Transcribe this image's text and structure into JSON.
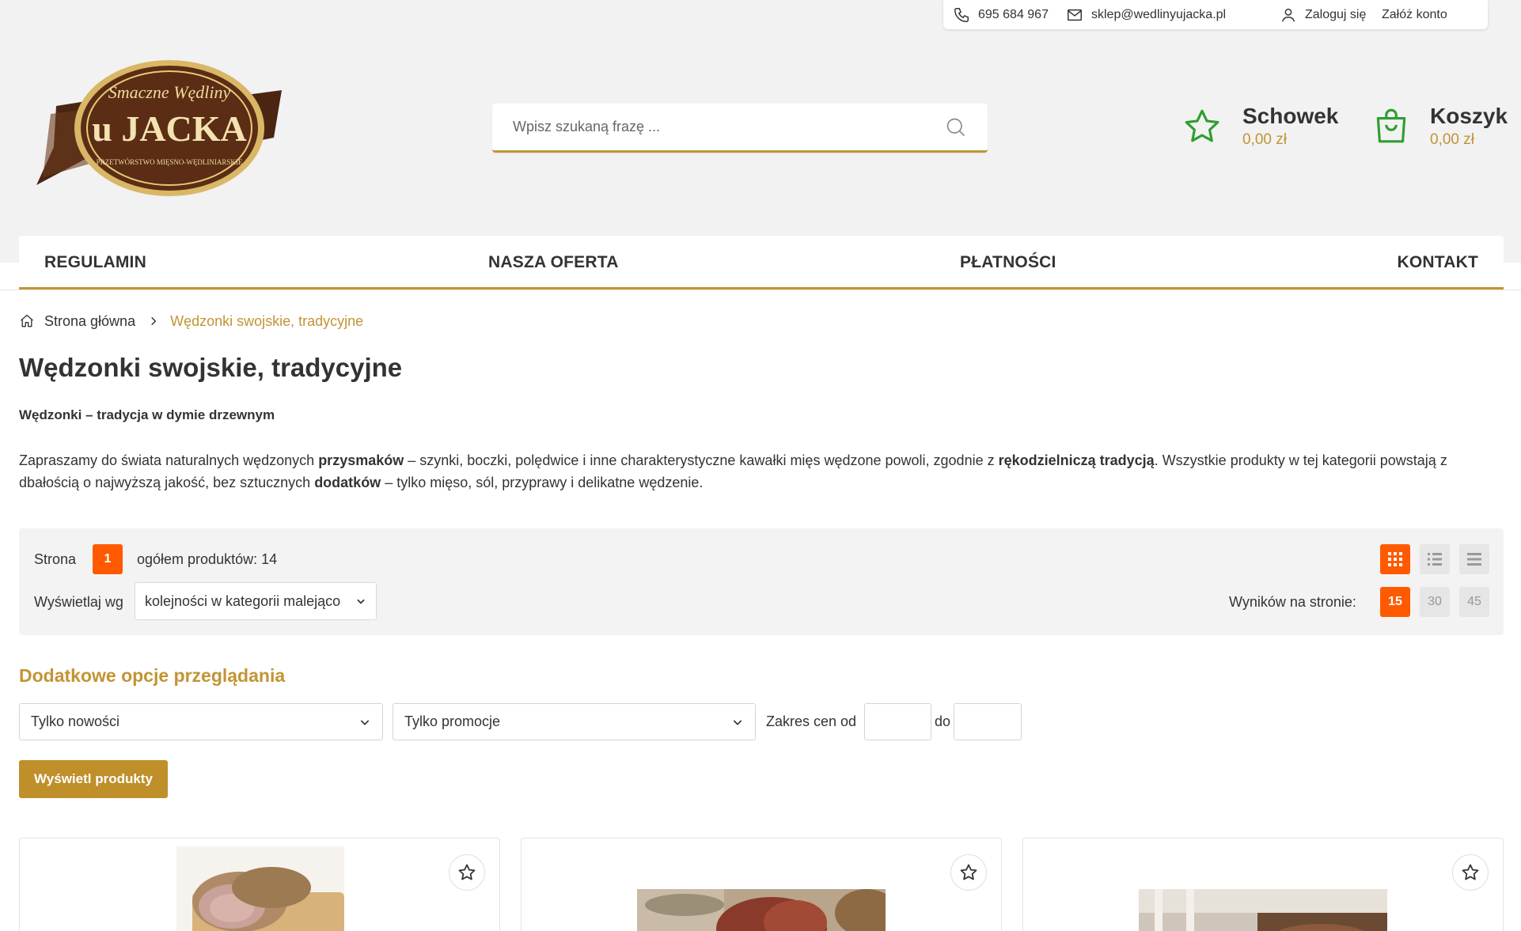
{
  "topbar": {
    "phone": "695 684 967",
    "email": "sklep@wedlinyujacka.pl",
    "login": "Zaloguj się",
    "register": "Załóż konto"
  },
  "logo": {
    "script_text": "Smaczne Wędliny",
    "main_text": "u JACKA",
    "ring_text": "PRZETWÓRSTWO MIĘSNO-WĘDLINIARSKIE"
  },
  "search": {
    "placeholder": "Wpisz szukaną frazę ..."
  },
  "wishlist": {
    "label": "Schowek",
    "amount": "0,00 zł"
  },
  "cart": {
    "label": "Koszyk",
    "amount": "0,00 zł"
  },
  "nav": {
    "items": [
      "REGULAMIN",
      "NASZA OFERTA",
      "PŁATNOŚCI",
      "KONTAKT"
    ]
  },
  "breadcrumb": {
    "home": "Strona główna",
    "current": "Wędzonki swojskie, tradycyjne"
  },
  "page": {
    "title": "Wędzonki swojskie, tradycyjne",
    "subhead": "Wędzonki – tradycja w dymie drzewnym",
    "desc": {
      "p1": "Zapraszamy do świata naturalnych wędzonych ",
      "b1": "przysmaków",
      "p2": " – szynki, boczki, polędwice i inne charakterystyczne kawałki mięs wędzone powoli, zgodnie z ",
      "b2": "rękodzielniczą tradycją",
      "p3": ". Wszystkie produkty w tej kategorii powstają z dbałością o najwyższą jakość, bez sztucznych ",
      "b3": "dodatków",
      "p4": " – tylko mięso, sól, przyprawy i delikatne wędzenie."
    }
  },
  "toolbar": {
    "page_label": "Strona",
    "current_page": "1",
    "total": "ogółem produktów: 14",
    "sort_label": "Wyświetlaj wg",
    "sort_value": "kolejności w kategorii malejąco",
    "per_page_label": "Wyników na stronie:",
    "per_page": [
      "15",
      "30",
      "45"
    ]
  },
  "options": {
    "title": "Dodatkowe opcje przeglądania",
    "new_only": "Tylko nowości",
    "promo_only": "Tylko promocje",
    "price_label": "Zakres cen od",
    "price_to": "do",
    "show_button": "Wyświetl produkty"
  },
  "colors": {
    "accent": "#c29433",
    "orange": "#ff5a00",
    "green": "#2e9e2e"
  }
}
